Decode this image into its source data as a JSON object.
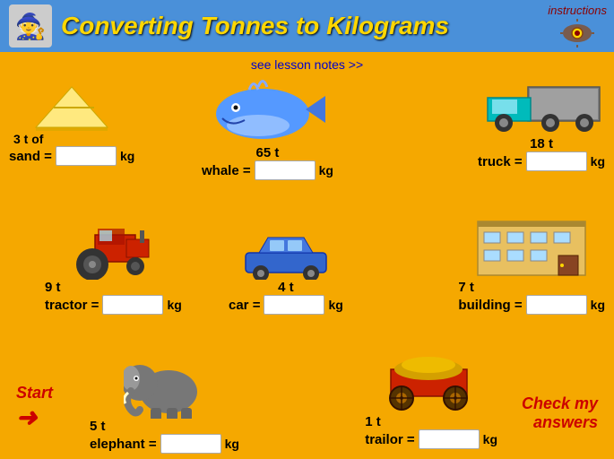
{
  "header": {
    "title": "Converting Tonnes to Kilograms",
    "avatar_icon": "🧙",
    "instructions_label": "instructions",
    "instructions_icon": "👁️"
  },
  "lesson_notes": "see lesson notes >>",
  "items": [
    {
      "id": "sand",
      "tonnes": "3 t of",
      "label": "sand =",
      "kg": "",
      "col": 0,
      "row": 0
    },
    {
      "id": "whale",
      "tonnes": "65 t",
      "label": "whale =",
      "kg": "",
      "col": 1,
      "row": 0
    },
    {
      "id": "truck",
      "tonnes": "18 t",
      "label": "truck =",
      "kg": "",
      "col": 2,
      "row": 0
    },
    {
      "id": "tractor",
      "tonnes": "9 t",
      "label": "tractor =",
      "kg": "",
      "col": 0,
      "row": 1
    },
    {
      "id": "car",
      "tonnes": "4 t",
      "label": "car =",
      "kg": "",
      "col": 1,
      "row": 1
    },
    {
      "id": "building",
      "tonnes": "7 t",
      "label": "building =",
      "kg": "",
      "col": 2,
      "row": 1
    },
    {
      "id": "elephant",
      "tonnes": "5 t",
      "label": "elephant =",
      "kg": "",
      "col": 0,
      "row": 2
    },
    {
      "id": "trailor",
      "tonnes": "1 t",
      "label": "trailor =",
      "kg": "",
      "col": 1,
      "row": 2
    }
  ],
  "start_label": "Start",
  "check_label": "Check my\nanswers",
  "kg_unit": "kg"
}
